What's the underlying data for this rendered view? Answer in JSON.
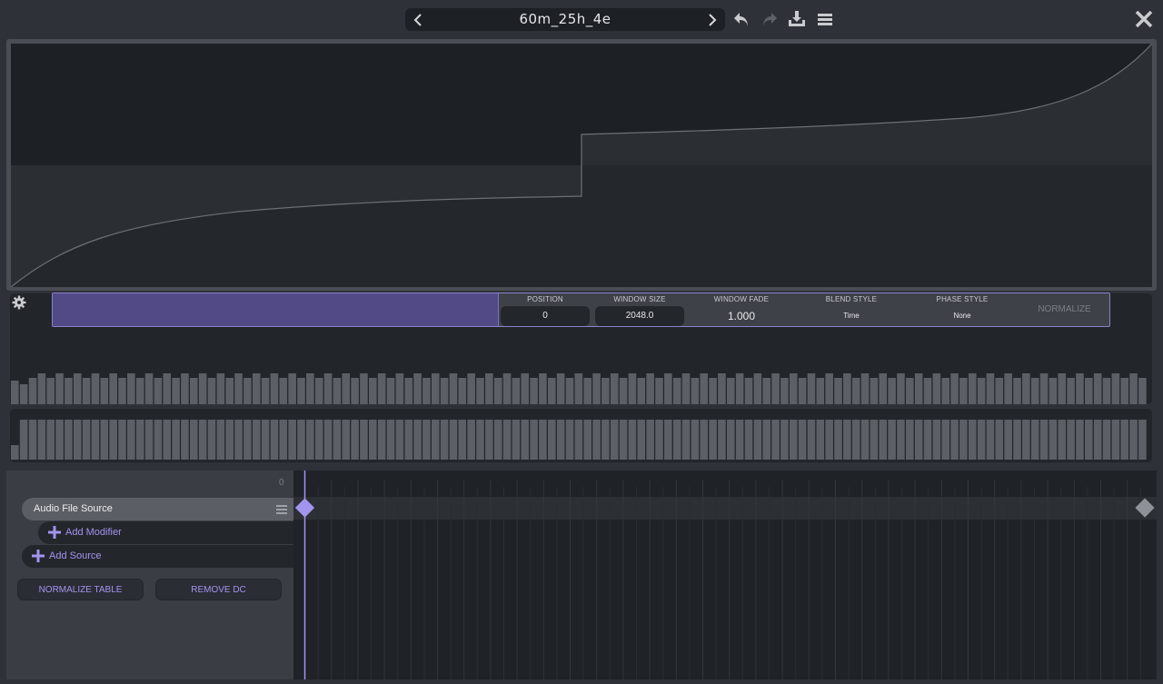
{
  "header": {
    "preset_name": "60m_25h_4e",
    "icons": {
      "prev": "chevron-left-icon",
      "next": "chevron-right-icon",
      "undo": "undo-icon",
      "redo": "redo-icon",
      "save": "save-icon",
      "menu": "menu-icon",
      "close": "close-icon"
    }
  },
  "window_params": {
    "position_label": "POSITION",
    "position_value": "0",
    "window_size_label": "WINDOW SIZE",
    "window_size_value": "2048.0",
    "window_fade_label": "WINDOW FADE",
    "window_fade_value": "1.000",
    "blend_style_label": "BLEND STYLE",
    "blend_style_value": "Time",
    "phase_style_label": "PHASE STYLE",
    "phase_style_value": "None",
    "normalize_label": "NORMALIZE"
  },
  "sources": {
    "timeline_start": "0",
    "audio_file_source": "Audio File Source",
    "add_modifier": "Add Modifier",
    "add_source": "Add Source",
    "normalize_table": "NORMALIZE TABLE",
    "remove_dc": "REMOVE DC"
  },
  "colors": {
    "accent": "#a394f0",
    "window_fill": "#524a87",
    "bar_fill": "#5c5f65",
    "panel_dark": "#22252a"
  }
}
